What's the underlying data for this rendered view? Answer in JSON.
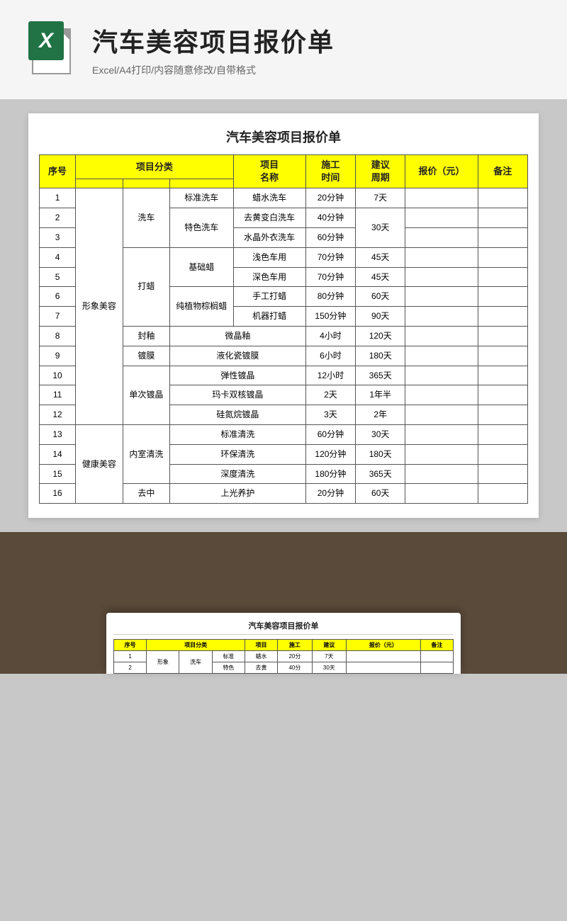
{
  "header": {
    "title": "汽车美容项目报价单",
    "subtitle": "Excel/A4打印/内容随意修改/自带格式",
    "excel_label": "X"
  },
  "doc": {
    "title": "汽车美容项目报价单"
  },
  "table": {
    "headers": {
      "seq": "序号",
      "category": "项目分类",
      "item_name": "项目\n名称",
      "time": "施工\n时间",
      "cycle": "建议\n周期",
      "price": "报价（元）",
      "note": "备注"
    },
    "rows": [
      {
        "seq": "1",
        "cat1": "形象美容",
        "cat2": "洗车",
        "cat3": "标准洗车",
        "name": "蜡水洗车",
        "time": "20分钟",
        "cycle": "7天",
        "price": "",
        "note": ""
      },
      {
        "seq": "2",
        "cat1": "",
        "cat2": "",
        "cat3": "特色洗车",
        "name": "去黄变白洗车",
        "time": "40分钟",
        "cycle": "30天",
        "price": "",
        "note": ""
      },
      {
        "seq": "3",
        "cat1": "",
        "cat2": "",
        "cat3": "",
        "name": "水晶外衣洗车",
        "time": "60分钟",
        "cycle": "",
        "price": "",
        "note": ""
      },
      {
        "seq": "4",
        "cat1": "",
        "cat2": "打蜡",
        "cat3": "基础蜡",
        "name": "浅色车用",
        "time": "70分钟",
        "cycle": "45天",
        "price": "",
        "note": ""
      },
      {
        "seq": "5",
        "cat1": "",
        "cat2": "",
        "cat3": "",
        "name": "深色车用",
        "time": "70分钟",
        "cycle": "45天",
        "price": "",
        "note": ""
      },
      {
        "seq": "6",
        "cat1": "",
        "cat2": "",
        "cat3": "纯植物棕榈蜡",
        "name": "手工打蜡",
        "time": "80分钟",
        "cycle": "60天",
        "price": "",
        "note": ""
      },
      {
        "seq": "7",
        "cat1": "",
        "cat2": "",
        "cat3": "",
        "name": "机器打蜡",
        "time": "150分钟",
        "cycle": "90天",
        "price": "",
        "note": ""
      },
      {
        "seq": "8",
        "cat1": "",
        "cat2": "封釉",
        "cat3": "微晶釉",
        "name": "",
        "time": "4小时",
        "cycle": "120天",
        "price": "",
        "note": ""
      },
      {
        "seq": "9",
        "cat1": "",
        "cat2": "镀膜",
        "cat3": "液化瓷镀膜",
        "name": "",
        "time": "6小时",
        "cycle": "180天",
        "price": "",
        "note": ""
      },
      {
        "seq": "10",
        "cat1": "",
        "cat2": "单次镀晶",
        "cat3": "弹性镀晶",
        "name": "",
        "time": "12小时",
        "cycle": "365天",
        "price": "",
        "note": ""
      },
      {
        "seq": "11",
        "cat1": "",
        "cat2": "",
        "cat3": "玛卡双核镀晶",
        "name": "",
        "time": "2天",
        "cycle": "1年半",
        "price": "",
        "note": ""
      },
      {
        "seq": "12",
        "cat1": "",
        "cat2": "",
        "cat3": "硅氮烷镀晶",
        "name": "",
        "time": "3天",
        "cycle": "2年",
        "price": "",
        "note": ""
      },
      {
        "seq": "13",
        "cat1": "健康美容",
        "cat2": "内室清洗",
        "cat3": "标准清洗",
        "name": "",
        "time": "60分钟",
        "cycle": "30天",
        "price": "",
        "note": ""
      },
      {
        "seq": "14",
        "cat1": "",
        "cat2": "",
        "cat3": "环保清洗",
        "name": "",
        "time": "120分钟",
        "cycle": "180天",
        "price": "",
        "note": ""
      },
      {
        "seq": "15",
        "cat1": "",
        "cat2": "",
        "cat3": "深度清洗",
        "name": "",
        "time": "180分钟",
        "cycle": "365天",
        "price": "",
        "note": ""
      },
      {
        "seq": "16",
        "cat1": "",
        "cat2": "去中",
        "cat3": "上光养护",
        "name": "",
        "time": "20分钟",
        "cycle": "60天",
        "price": "",
        "note": ""
      }
    ]
  },
  "preview": {
    "title": "汽车美容项目报价单",
    "col_headers": [
      "序号",
      "项目分类",
      "项目",
      "施工",
      "建议",
      "报价（元）",
      "备注"
    ]
  }
}
